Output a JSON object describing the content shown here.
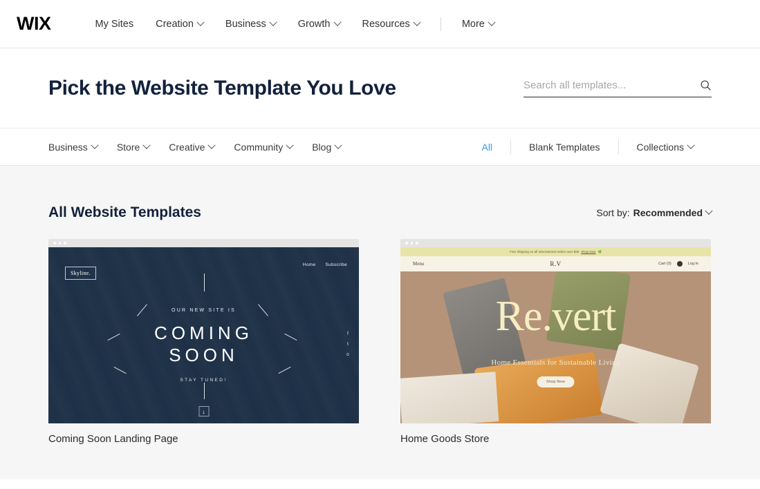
{
  "topnav": {
    "logo": "WIX",
    "items": [
      {
        "label": "My Sites",
        "caret": false
      },
      {
        "label": "Creation",
        "caret": true
      },
      {
        "label": "Business",
        "caret": true
      },
      {
        "label": "Growth",
        "caret": true
      },
      {
        "label": "Resources",
        "caret": true
      }
    ],
    "more": {
      "label": "More",
      "caret": true
    }
  },
  "header": {
    "title": "Pick the Website Template You Love",
    "search": {
      "placeholder": "Search all templates...",
      "value": "",
      "icon": "search-icon"
    }
  },
  "categorybar": {
    "categories": [
      {
        "label": "Business",
        "caret": true
      },
      {
        "label": "Store",
        "caret": true
      },
      {
        "label": "Creative",
        "caret": true
      },
      {
        "label": "Community",
        "caret": true
      },
      {
        "label": "Blog",
        "caret": true
      }
    ],
    "filters": [
      {
        "label": "All",
        "active": true,
        "caret": false
      },
      {
        "label": "Blank Templates",
        "active": false,
        "caret": false
      },
      {
        "label": "Collections",
        "active": false,
        "caret": true
      }
    ],
    "active_color": "#3899ec"
  },
  "main": {
    "section_title": "All Website Templates",
    "sort": {
      "label": "Sort by:",
      "value": "Recommended",
      "icon": "chevron-down-icon"
    },
    "templates": [
      {
        "caption": "Coming Soon Landing Page",
        "preview": {
          "logo": "Skyline.",
          "nav": [
            "Home",
            "Subscribe"
          ],
          "pretitle": "OUR NEW SITE IS",
          "title_line1": "COMING",
          "title_line2": "SOON",
          "posttitle": "STAY TUNED!",
          "social": [
            "f",
            "t",
            "o"
          ],
          "scroll_arrow": "↓"
        }
      },
      {
        "caption": "Home Goods Store",
        "preview": {
          "banner_text": "Free shipping on all international orders over $35",
          "banner_link": "Shop Now",
          "banner_emoji": "🌿",
          "menu": "Menu",
          "brand": "R.V",
          "cart": "Cart (0)",
          "login": "Log In",
          "title": "Re.vert",
          "subtitle": "Home Essentials for Sustainable Living",
          "button": "Shop Now"
        }
      }
    ]
  }
}
